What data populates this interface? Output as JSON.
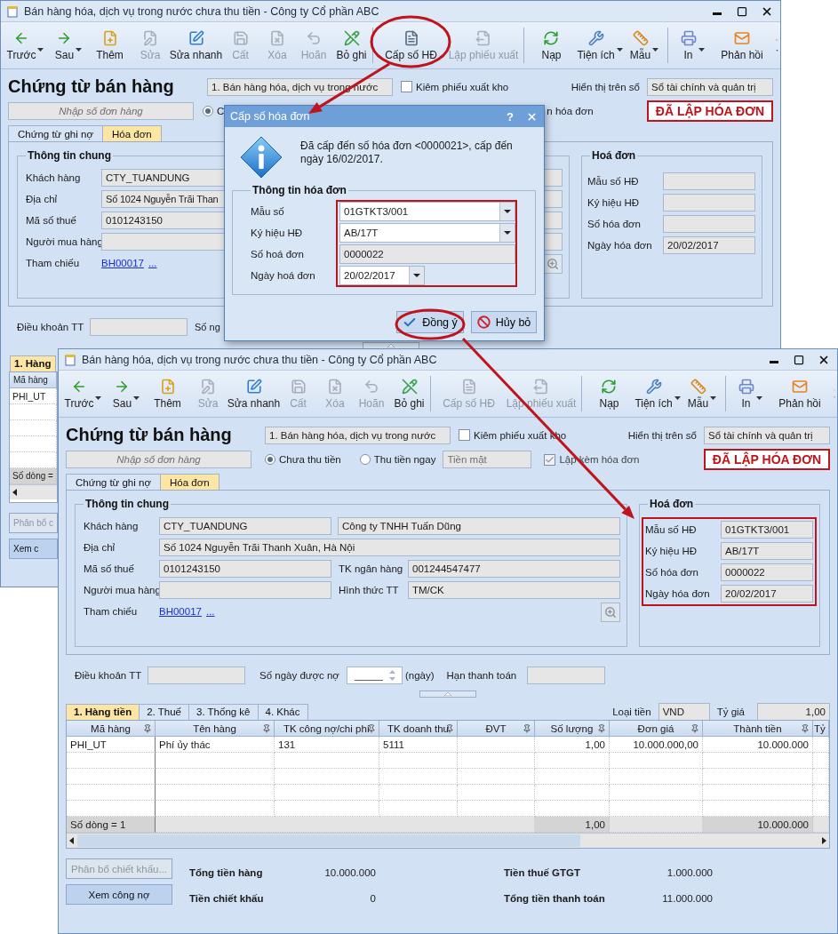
{
  "back_window": {
    "title": "Bán hàng hóa, dịch vụ trong nước chưa thu tiền - Công ty Cổ phần ABC",
    "toolbar": [
      [
        {
          "label": "Trước",
          "dropdown": true,
          "disabled": false
        },
        {
          "label": "Sau",
          "dropdown": true,
          "disabled": false
        },
        {
          "label": "Thêm",
          "dropdown": false,
          "disabled": false
        },
        {
          "label": "Sửa",
          "dropdown": false,
          "disabled": true
        },
        {
          "label": "Sửa nhanh",
          "dropdown": false,
          "disabled": false
        },
        {
          "label": "Cất",
          "dropdown": false,
          "disabled": true
        },
        {
          "label": "Xóa",
          "dropdown": false,
          "disabled": true
        },
        {
          "label": "Hoãn",
          "dropdown": false,
          "disabled": true
        },
        {
          "label": "Bỏ ghi",
          "dropdown": false,
          "disabled": false
        }
      ],
      [
        {
          "label": "Cấp số HĐ",
          "dropdown": false,
          "disabled": false
        },
        {
          "label": "Lập phiếu xuất",
          "dropdown": false,
          "disabled": true
        }
      ],
      [
        {
          "label": "Nạp",
          "dropdown": false,
          "disabled": false
        },
        {
          "label": "Tiện ích",
          "dropdown": true,
          "disabled": false
        },
        {
          "label": "Mẫu",
          "dropdown": true,
          "disabled": false
        }
      ],
      [
        {
          "label": "In",
          "dropdown": true,
          "disabled": false
        },
        {
          "label": "Phản hồi",
          "dropdown": false,
          "disabled": false
        }
      ]
    ],
    "heading": "Chứng từ bán hàng",
    "voucher_type": "1. Bán hàng hóa, dịch vụ trong nước",
    "export_checkbox": {
      "label": "Kiêm phiếu xuất kho",
      "checked": false
    },
    "display_on": {
      "label": "Hiển thị trên sổ",
      "value": "Sổ tài chính và quản trị"
    },
    "order_field": {
      "placeholder": "Nhập số đơn hàng"
    },
    "payment_option": {
      "label": "C",
      "selected": true
    },
    "invoice_option_text": "n hóa đơn",
    "status_badge": "ĐÃ LẬP HÓA ĐƠN",
    "doc_tabs": [
      {
        "label": "Chứng từ ghi nợ",
        "selected": false
      },
      {
        "label": "Hóa đơn",
        "selected": true
      }
    ],
    "general_info": {
      "title": "Thông tin chung",
      "rows": [
        {
          "kind": "pair",
          "label": "Khách hàng",
          "value": "CTY_TUANDUNG"
        },
        {
          "kind": "wide",
          "label": "Địa chỉ",
          "value": "Số 1024 Nguyễn Trãi Than"
        },
        {
          "kind": "split",
          "label": "Mã số thuế",
          "value": "0101243150"
        },
        {
          "kind": "split",
          "label": "Người mua hàng"
        },
        {
          "kind": "link",
          "label": "Tham chiếu",
          "links": [
            "BH00017",
            "..."
          ]
        }
      ]
    },
    "invoice_box": {
      "title": "Hoá đơn",
      "highlighted": false,
      "rows": [
        {
          "label": "Mẫu số HĐ"
        },
        {
          "label": "Ký hiệu HĐ"
        },
        {
          "label": "Số hóa đơn"
        },
        {
          "label": "Ngày hóa đơn",
          "value": "20/02/2017"
        }
      ]
    },
    "terms": {
      "label": "Điều khoản TT",
      "next_label": "Số ng"
    },
    "detail_tab": {
      "label": "1. Hàng",
      "selected": true
    },
    "grid": {
      "column": "Mã hàng",
      "cell": "PHI_UT",
      "footer": "Số dòng ="
    },
    "buttons": [
      {
        "label": "Phân bổ c",
        "disabled": true
      },
      {
        "label": "Xem c",
        "disabled": false
      }
    ]
  },
  "dialog": {
    "title": "Cấp số hóa đơn",
    "help": "?",
    "message": "Đã cấp đến số hóa đơn <0000021>, cấp đến ngày 16/02/2017.",
    "group_title": "Thông tin hóa đơn",
    "highlighted": true,
    "fields": [
      {
        "kind": "combo",
        "label": "Mẫu số",
        "value": "01GTKT3/001"
      },
      {
        "kind": "combo",
        "label": "Ký hiệu HĐ",
        "value": "AB/17T"
      },
      {
        "kind": "readonly",
        "label": "Số hoá đơn",
        "value": "0000022"
      },
      {
        "kind": "date",
        "label": "Ngày hoá đơn",
        "value": "20/02/2017"
      }
    ],
    "buttons": [
      {
        "kind": "confirm",
        "label": "Đồng ý"
      },
      {
        "kind": "cancel",
        "label": "Hủy bỏ"
      }
    ]
  },
  "front_window": {
    "title": "Bán hàng hóa, dịch vụ trong nước chưa thu tiền - Công ty Cổ phần ABC",
    "toolbar": [
      [
        {
          "label": "Trước",
          "dropdown": true,
          "disabled": false
        },
        {
          "label": "Sau",
          "dropdown": true,
          "disabled": false
        },
        {
          "label": "Thêm",
          "dropdown": false,
          "disabled": false
        },
        {
          "label": "Sửa",
          "dropdown": false,
          "disabled": true
        },
        {
          "label": "Sửa nhanh",
          "dropdown": false,
          "disabled": false
        },
        {
          "label": "Cất",
          "dropdown": false,
          "disabled": true
        },
        {
          "label": "Xóa",
          "dropdown": false,
          "disabled": true
        },
        {
          "label": "Hoãn",
          "dropdown": false,
          "disabled": true
        },
        {
          "label": "Bỏ ghi",
          "dropdown": false,
          "disabled": false
        }
      ],
      [
        {
          "label": "Cấp số HĐ",
          "dropdown": false,
          "disabled": true
        },
        {
          "label": "Lập phiếu xuất",
          "dropdown": false,
          "disabled": true
        }
      ],
      [
        {
          "label": "Nạp",
          "dropdown": false,
          "disabled": false
        },
        {
          "label": "Tiện ích",
          "dropdown": true,
          "disabled": false
        },
        {
          "label": "Mẫu",
          "dropdown": true,
          "disabled": false
        }
      ],
      [
        {
          "label": "In",
          "dropdown": true,
          "disabled": false
        },
        {
          "label": "Phản hồi",
          "dropdown": false,
          "disabled": false
        }
      ]
    ],
    "heading": "Chứng từ bán hàng",
    "voucher_type": "1. Bán hàng hóa, dịch vụ trong nước",
    "export_checkbox": {
      "label": "Kiêm phiếu xuất kho",
      "checked": false
    },
    "display_on": {
      "label": "Hiển thị trên sổ",
      "value": "Sổ tài chính và quản trị"
    },
    "order_field": {
      "placeholder": "Nhập số đơn hàng"
    },
    "payment_options": [
      {
        "label": "Chưa thu tiền",
        "selected": true
      },
      {
        "label": "Thu tiền ngay",
        "selected": false
      }
    ],
    "cash_field": {
      "value": "Tiền mặt",
      "disabled": true
    },
    "invoice_checkbox": {
      "label": "Lập kèm hóa đơn",
      "checked": true,
      "disabled": true
    },
    "status_badge": "ĐÃ LẬP HÓA ĐƠN",
    "doc_tabs": [
      {
        "label": "Chứng từ ghi nợ",
        "selected": false
      },
      {
        "label": "Hóa đơn",
        "selected": true
      }
    ],
    "general_info": {
      "title": "Thông tin chung",
      "rows": [
        {
          "kind": "pair",
          "label": "Khách hàng",
          "value": "CTY_TUANDUNG",
          "value2": "Công ty TNHH Tuấn Dũng"
        },
        {
          "kind": "wide",
          "label": "Địa chỉ",
          "value": "Số 1024 Nguyễn Trãi Thanh Xuân, Hà Nội"
        },
        {
          "kind": "split",
          "label": "Mã số thuế",
          "value": "0101243150",
          "label2": "TK ngân hàng",
          "value2": "001244547477"
        },
        {
          "kind": "split",
          "label": "Người mua hàng",
          "label2": "Hình thức TT",
          "value2": "TM/CK"
        },
        {
          "kind": "link",
          "label": "Tham chiếu",
          "links": [
            "BH00017",
            "..."
          ]
        }
      ]
    },
    "invoice_box": {
      "title": "Hoá đơn",
      "highlighted": true,
      "rows": [
        {
          "label": "Mẫu số HĐ",
          "value": "01GTKT3/001"
        },
        {
          "label": "Ký hiệu HĐ",
          "value": "AB/17T"
        },
        {
          "label": "Số hóa đơn",
          "value": "0000022"
        },
        {
          "label": "Ngày hóa đơn",
          "value": "20/02/2017"
        }
      ]
    },
    "terms": {
      "label": "Điều khoản TT",
      "days_label": "Số ngày được nợ",
      "days_value": "_____",
      "days_unit": "(ngày)",
      "due_label": "Hạn thanh toán"
    },
    "detail_tabs": [
      {
        "label": "1. Hàng tiền",
        "selected": true
      },
      {
        "label": "2. Thuế",
        "selected": false
      },
      {
        "label": "3. Thống kê",
        "selected": false
      },
      {
        "label": "4. Khác",
        "selected": false
      }
    ],
    "currency": {
      "label": "Loại tiền",
      "value": "VND",
      "rate_label": "Tỷ giá",
      "rate": "1,00"
    },
    "grid": {
      "columns": [
        "Mã hàng",
        "Tên hàng",
        "TK công nợ/chi phí",
        "TK doanh thu",
        "ĐVT",
        "Số lượng",
        "Đơn giá",
        "Thành tiền",
        "Tỷ"
      ],
      "rows": [
        [
          "PHI_UT",
          "Phí ủy thác",
          "131",
          "5111",
          null,
          "1,00",
          "10.000.000,00",
          "10.000.000",
          null
        ]
      ],
      "footer": {
        "row_count": "Số dòng = 1",
        "quantity_total": "1,00",
        "amount_total": "10.000.000"
      }
    },
    "buttons": [
      {
        "label": "Phân bổ chiết khấu...",
        "disabled": true
      },
      {
        "label": "Xem công nợ",
        "disabled": false
      }
    ],
    "totals": [
      {
        "label": "Tổng tiền hàng",
        "value": "10.000.000"
      },
      {
        "label": "Tiền thuế GTGT",
        "value": "1.000.000"
      },
      {
        "label": "Tiền chiết khấu",
        "value": "0"
      },
      {
        "label": "Tổng tiền thanh toán",
        "value": "11.000.000"
      }
    ]
  }
}
